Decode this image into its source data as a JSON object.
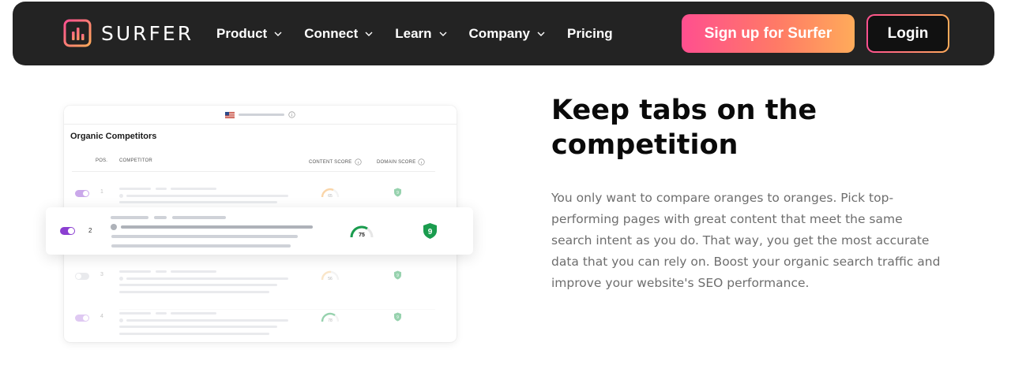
{
  "nav": {
    "logo_text": "SURFER",
    "logo_icon": "surfer-bar-chart-icon",
    "items": [
      {
        "label": "Product",
        "has_dropdown": true
      },
      {
        "label": "Connect",
        "has_dropdown": true
      },
      {
        "label": "Learn",
        "has_dropdown": true
      },
      {
        "label": "Company",
        "has_dropdown": true
      },
      {
        "label": "Pricing",
        "has_dropdown": false
      }
    ],
    "signup_label": "Sign up for Surfer",
    "login_label": "Login"
  },
  "card": {
    "title": "Organic Competitors",
    "columns": {
      "pos": "POS.",
      "competitor": "COMPETITOR",
      "content_score": "CONTENT SCORE",
      "domain_score": "DOMAIN SCORE"
    },
    "rows": [
      {
        "pos": "1",
        "enabled": true,
        "content_score": "65",
        "domain_score": "9",
        "faded": true
      },
      {
        "pos": "2",
        "enabled": true,
        "content_score": "75",
        "domain_score": "9",
        "faded": false,
        "highlighted": true
      },
      {
        "pos": "3",
        "enabled": false,
        "content_score": "56",
        "domain_score": "9",
        "faded": true
      },
      {
        "pos": "4",
        "enabled": true,
        "content_score": "78",
        "domain_score": "9",
        "faded": true
      }
    ]
  },
  "content": {
    "heading": "Keep tabs on the competition",
    "body": "You only want to compare oranges to oranges. Pick top-performing pages with great content that meet the same search intent as you do. That way, you get the most accurate data that you can rely on. Boost your organic search traffic and improve your website's SEO performance."
  },
  "colors": {
    "nav_bg": "#232323",
    "gradient_start": "#ff4f8f",
    "gradient_end": "#ffab5a",
    "toggle_on": "#8b3fd1",
    "score_green": "#1a9c4e",
    "score_orange": "#f4a340"
  }
}
